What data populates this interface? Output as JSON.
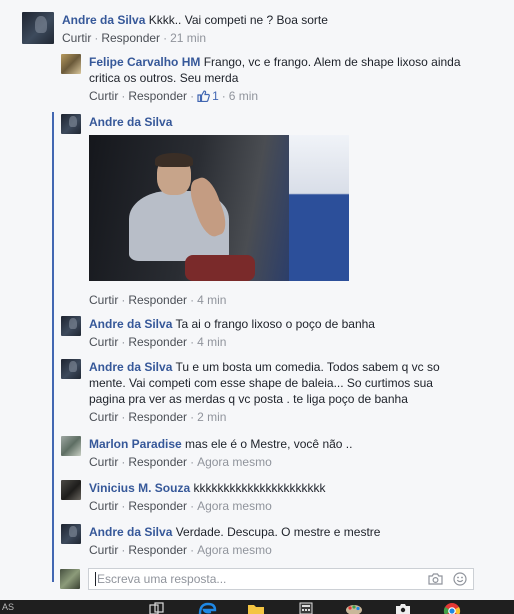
{
  "comments": [
    {
      "author": "Andre da Silva",
      "text": "Kkkk.. Vai competi ne ? Boa sorte",
      "actions": {
        "reply_a": "Curtir",
        "reply_b": "Responder",
        "time": "21 min"
      }
    },
    {
      "author": "Felipe Carvalho HM",
      "text": "Frango, vc e frango. Alem de shape lixoso ainda critica os outros. Seu merda",
      "actions": {
        "reply_a": "Curtir",
        "reply_b": "Responder",
        "likes": "1",
        "time": "6 min"
      }
    },
    {
      "author": "Andre da Silva",
      "text": "",
      "actions": {
        "reply_a": "Curtir",
        "reply_b": "Responder",
        "time": "4 min"
      }
    },
    {
      "author": "Andre da Silva",
      "text": "Ta ai o frango lixoso o poço de banha",
      "actions": {
        "reply_a": "Curtir",
        "reply_b": "Responder",
        "time": "4 min"
      }
    },
    {
      "author": "Andre da Silva",
      "text": "Tu e um bosta um comedia. Todos sabem q vc so mente. Vai competi com esse shape de baleia... So curtimos sua pagina pra ver as merdas q vc posta . te liga poço de banha",
      "actions": {
        "reply_a": "Curtir",
        "reply_b": "Responder",
        "time": "2 min"
      }
    },
    {
      "author": "Marlon Paradise",
      "text": "mas ele é o Mestre, você não ..",
      "actions": {
        "reply_a": "Curtir",
        "reply_b": "Responder",
        "time": "Agora mesmo"
      }
    },
    {
      "author": "Vinicius M. Souza",
      "text": "kkkkkkkkkkkkkkkkkkkkkk",
      "actions": {
        "reply_a": "Curtir",
        "reply_b": "Responder",
        "time": "Agora mesmo"
      }
    },
    {
      "author": "Andre da Silva",
      "text": "Verdade. Descupa. O mestre e mestre",
      "actions": {
        "reply_a": "Curtir",
        "reply_b": "Responder",
        "time": "Agora mesmo"
      }
    }
  ],
  "composer": {
    "placeholder": "Escreva uma resposta..."
  },
  "taskbar": {
    "fragment": "AS"
  },
  "colors": {
    "link": "#365899",
    "accent": "#4267b2",
    "muted": "#90949c"
  },
  "icons": [
    "thumbs-up-icon",
    "camera-icon",
    "smiley-icon",
    "task-view-icon",
    "edge-icon",
    "folder-icon",
    "calculator-icon",
    "paint-icon",
    "camera-app-icon",
    "chrome-icon"
  ]
}
